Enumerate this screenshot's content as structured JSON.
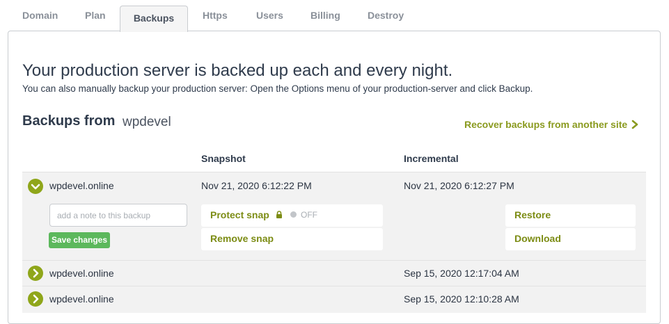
{
  "tabs": [
    {
      "label": "Domain"
    },
    {
      "label": "Plan"
    },
    {
      "label": "Backups"
    },
    {
      "label": "Https"
    },
    {
      "label": "Users"
    },
    {
      "label": "Billing"
    },
    {
      "label": "Destroy"
    }
  ],
  "active_tab": "Backups",
  "headline": "Your production server is backed up each and every night.",
  "subline": "You can also manually backup your production server: Open the Options menu of your production-server and click Backup.",
  "backups": {
    "title": "Backups from",
    "site": "wpdevel",
    "recover_link": "Recover backups from another site",
    "columns": {
      "snapshot": "Snapshot",
      "incremental": "Incremental"
    },
    "rows": [
      {
        "name": "wpdevel.online",
        "snapshot": "Nov 21, 2020 6:12:22 PM",
        "incremental": "Nov 21, 2020 6:12:27 PM",
        "expanded": true,
        "note_placeholder": "add a note to this backup",
        "save_label": "Save changes",
        "protect_label": "Protect snap",
        "protect_state": "OFF",
        "remove_label": "Remove snap",
        "restore_label": "Restore",
        "download_label": "Download"
      },
      {
        "name": "wpdevel.online",
        "snapshot": "",
        "incremental": "Sep 15, 2020 12:17:04 AM",
        "expanded": false
      },
      {
        "name": "wpdevel.online",
        "snapshot": "",
        "incremental": "Sep 15, 2020 12:10:28 AM",
        "expanded": false
      }
    ]
  },
  "colors": {
    "accent_olive": "#8fa61a",
    "link_olive": "#8a9a1f",
    "save_green": "#5cb85c",
    "text_dark": "#2f3b4c"
  },
  "icons": {
    "expanded_row": "chevron-down-icon",
    "collapsed_row": "chevron-right-icon",
    "recover": "chevron-right-icon",
    "protect": "lock-icon"
  }
}
